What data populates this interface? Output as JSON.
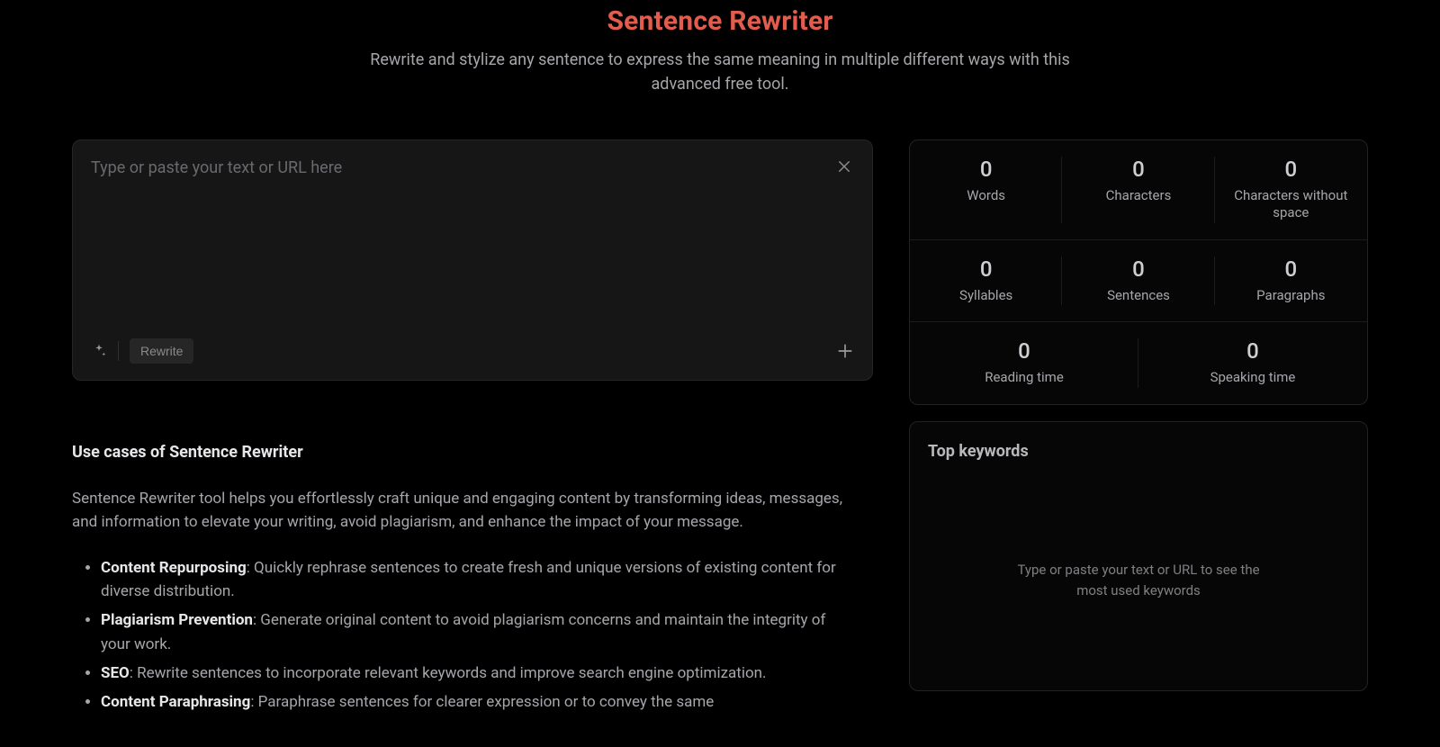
{
  "header": {
    "title": "Sentence Rewriter",
    "subtitle": "Rewrite and stylize any sentence to express the same meaning in multiple different ways with this advanced free tool."
  },
  "editor": {
    "placeholder": "Type or paste your text or URL here",
    "rewrite_label": "Rewrite"
  },
  "stats": {
    "words": {
      "value": "0",
      "label": "Words"
    },
    "chars": {
      "value": "0",
      "label": "Characters"
    },
    "chars_ns": {
      "value": "0",
      "label": "Characters without space"
    },
    "syllables": {
      "value": "0",
      "label": "Syllables"
    },
    "sentences": {
      "value": "0",
      "label": "Sentences"
    },
    "paragraphs": {
      "value": "0",
      "label": "Paragraphs"
    },
    "reading": {
      "value": "0",
      "label": "Reading time"
    },
    "speaking": {
      "value": "0",
      "label": "Speaking time"
    }
  },
  "keywords": {
    "heading": "Top keywords",
    "placeholder": "Type or paste your text or URL to see the most used keywords"
  },
  "usecases": {
    "heading": "Use cases of Sentence Rewriter",
    "intro": "Sentence Rewriter tool helps you effortlessly craft unique and engaging content by transforming ideas, messages, and information to elevate your writing, avoid plagiarism, and enhance the impact of your message.",
    "items": [
      {
        "label": "Content Repurposing",
        "text": ": Quickly rephrase sentences to create fresh and unique versions of existing content for diverse distribution."
      },
      {
        "label": "Plagiarism Prevention",
        "text": ": Generate original content to avoid plagiarism concerns and maintain the integrity of your work."
      },
      {
        "label": "SEO",
        "text": ": Rewrite sentences to incorporate relevant keywords and improve search engine optimization."
      },
      {
        "label": "Content Paraphrasing",
        "text": ": Paraphrase sentences for clearer expression or to convey the same"
      }
    ]
  }
}
